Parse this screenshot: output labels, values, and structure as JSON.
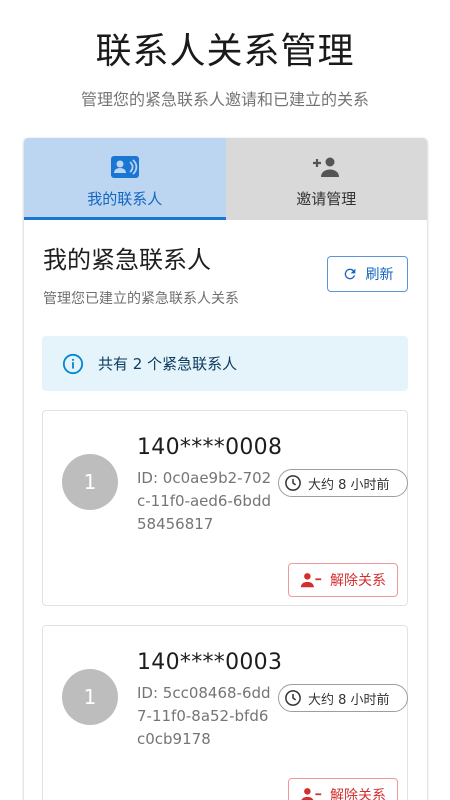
{
  "header": {
    "title": "联系人关系管理",
    "subtitle": "管理您的紧急联系人邀请和已建立的关系"
  },
  "tabs": [
    {
      "label": "我的联系人",
      "icon": "contact-card-icon",
      "active": true
    },
    {
      "label": "邀请管理",
      "icon": "person-add-icon",
      "active": false
    }
  ],
  "section": {
    "title": "我的紧急联系人",
    "subtitle": "管理您已建立的紧急联系人关系",
    "refresh_label": "刷新"
  },
  "info": {
    "text": "共有 2 个紧急联系人"
  },
  "contacts": [
    {
      "avatar": "1",
      "phone": "140****0008",
      "id_text": "ID: 0c0ae9b2-702c-11f0-aed6-6bdd58456817",
      "time": "大约 8 小时前",
      "remove_label": "解除关系"
    },
    {
      "avatar": "1",
      "phone": "140****0003",
      "id_text": "ID: 5cc08468-6dd7-11f0-8a52-bfd6c0cb9178",
      "time": "大约 8 小时前",
      "remove_label": "解除关系"
    }
  ],
  "colors": {
    "primary": "#1976d2",
    "tab_active_bg": "#bcd6f2",
    "tab_inactive_bg": "#d9d9d9",
    "info_bg": "#e5f4fb",
    "danger": "#d32f2f"
  }
}
